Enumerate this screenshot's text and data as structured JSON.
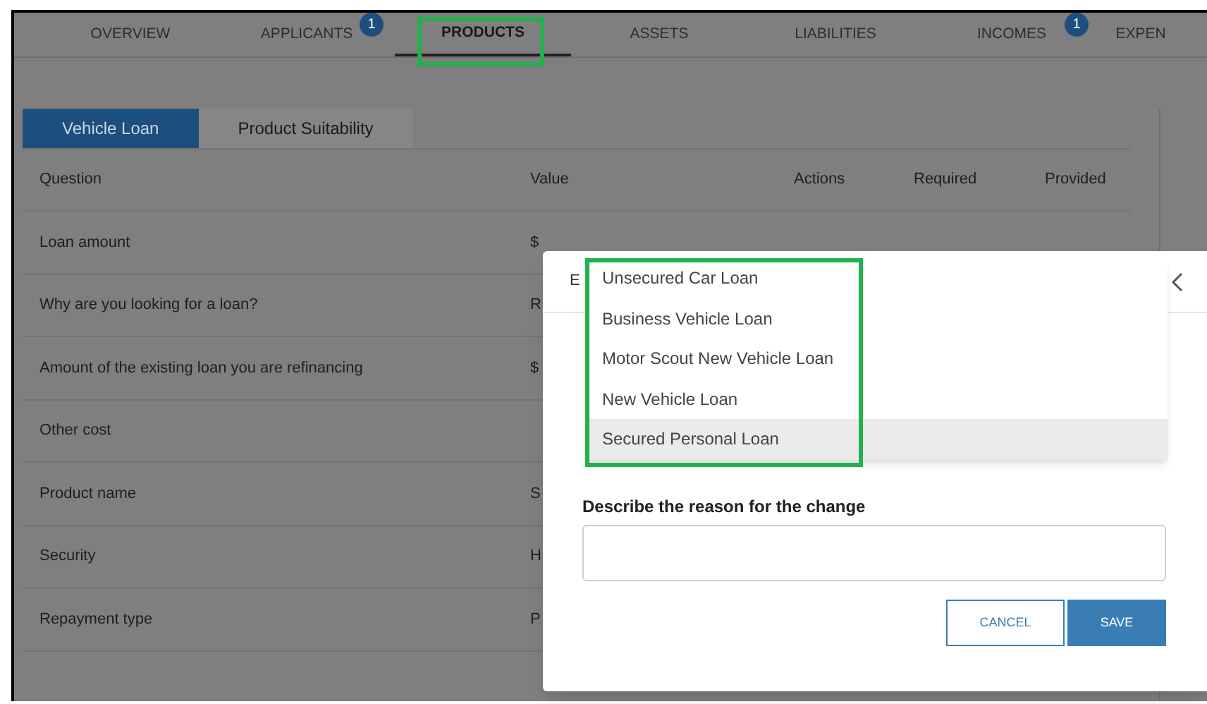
{
  "tabs": [
    {
      "label": "OVERVIEW",
      "selected": false
    },
    {
      "label": "APPLICANTS",
      "selected": false,
      "badge": "1"
    },
    {
      "label": "PRODUCTS",
      "selected": true
    },
    {
      "label": "ASSETS",
      "selected": false
    },
    {
      "label": "LIABILITIES",
      "selected": false
    },
    {
      "label": "INCOMES",
      "selected": false,
      "badge": "1"
    },
    {
      "label": "EXPEN",
      "selected": false
    }
  ],
  "subtabs": [
    {
      "label": "Vehicle Loan",
      "selected": true
    },
    {
      "label": "Product Suitability",
      "selected": false
    }
  ],
  "table": {
    "columns": [
      "Question",
      "Value",
      "Actions",
      "Required",
      "Provided"
    ],
    "rows": [
      {
        "question": "Loan amount",
        "value": "$"
      },
      {
        "question": "Why are you looking for a loan?",
        "value": "R"
      },
      {
        "question": "Amount of the existing loan you are refinancing",
        "value": "$"
      },
      {
        "question": "Other cost"
      },
      {
        "question": "Product name",
        "value": "S"
      },
      {
        "question": "Security",
        "value": "H"
      },
      {
        "question": "Repayment type",
        "value": "P"
      }
    ]
  },
  "dialog": {
    "title": "E",
    "options": [
      {
        "label": "Unsecured Car Loan",
        "selected": false
      },
      {
        "label": "Business Vehicle Loan",
        "selected": false
      },
      {
        "label": "Motor Scout New Vehicle Loan",
        "selected": false
      },
      {
        "label": "New Vehicle Loan",
        "selected": false
      },
      {
        "label": "Secured Personal Loan",
        "selected": true
      }
    ],
    "reason_label": "Describe the reason for the change",
    "buttons": [
      {
        "label": "CANCEL",
        "kind": "secondary"
      },
      {
        "label": "SAVE",
        "kind": "primary"
      }
    ]
  }
}
